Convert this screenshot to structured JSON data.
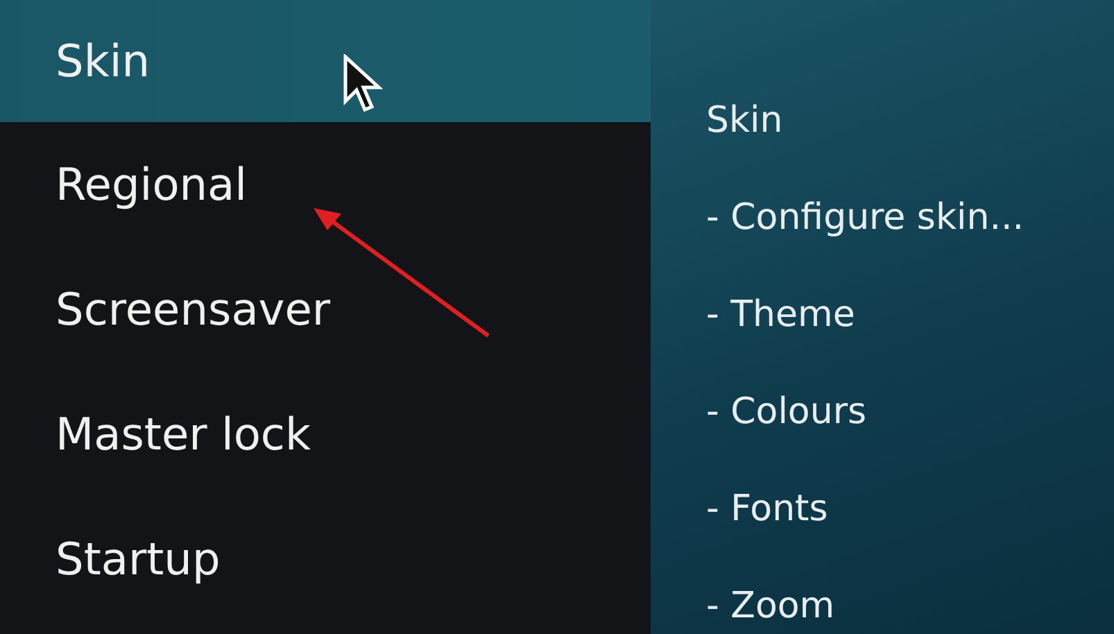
{
  "menu": [
    {
      "label": "Skin",
      "selected": true
    },
    {
      "label": "Regional",
      "selected": false
    },
    {
      "label": "Screensaver",
      "selected": false
    },
    {
      "label": "Master lock",
      "selected": false
    },
    {
      "label": "Startup",
      "selected": false
    }
  ],
  "details": [
    "Skin",
    "- Configure skin...",
    "- Theme",
    "- Colours",
    "- Fonts",
    "- Zoom"
  ]
}
